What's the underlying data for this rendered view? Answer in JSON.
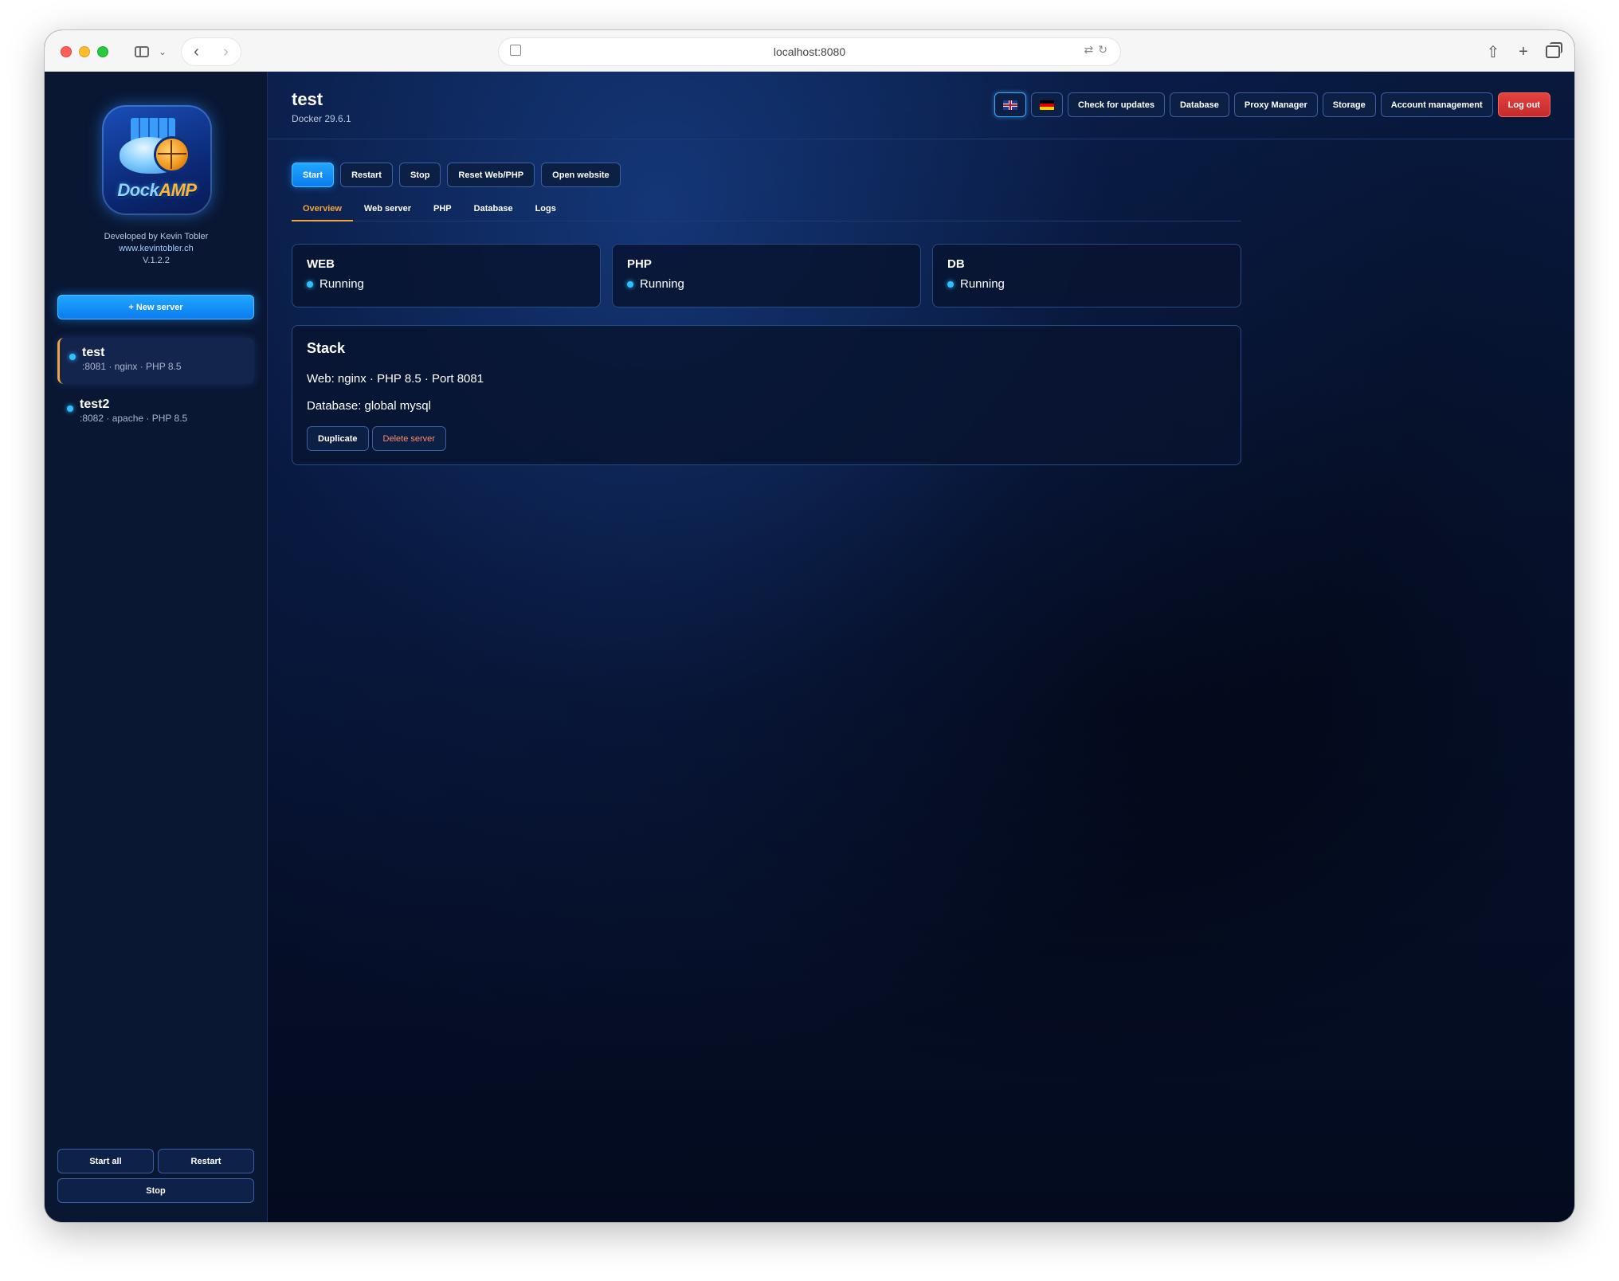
{
  "browser": {
    "url": "localhost:8080"
  },
  "sidebar": {
    "logo": {
      "text_part1": "Dock",
      "text_part2": "AMP"
    },
    "credits": {
      "developer": "Developed by Kevin Tobler",
      "website": "www.kevintobler.ch",
      "version": "V.1.2.2"
    },
    "new_server_label": "+ New server",
    "servers": [
      {
        "name": "test",
        "meta": ":8081 · nginx · PHP 8.5",
        "active": true
      },
      {
        "name": "test2",
        "meta": ":8082 · apache · PHP 8.5",
        "active": false
      }
    ],
    "start_all_label": "Start all",
    "restart_label": "Restart",
    "stop_label": "Stop"
  },
  "header": {
    "title": "test",
    "subtitle": "Docker 29.6.1",
    "buttons": {
      "check_updates": "Check for updates",
      "database": "Database",
      "proxy_manager": "Proxy Manager",
      "storage": "Storage",
      "account_management": "Account management",
      "logout": "Log out"
    }
  },
  "actions": {
    "start": "Start",
    "restart": "Restart",
    "stop": "Stop",
    "reset": "Reset Web/PHP",
    "open_website": "Open website"
  },
  "tabs": [
    "Overview",
    "Web server",
    "PHP",
    "Database",
    "Logs"
  ],
  "status_cards": [
    {
      "title": "WEB",
      "status": "Running"
    },
    {
      "title": "PHP",
      "status": "Running"
    },
    {
      "title": "DB",
      "status": "Running"
    }
  ],
  "stack": {
    "title": "Stack",
    "web_line": "Web: nginx · PHP 8.5 · Port 8081",
    "db_line": "Database: global mysql",
    "duplicate_label": "Duplicate",
    "delete_label": "Delete server"
  },
  "colors": {
    "accent_blue": "#0a7cf0",
    "accent_orange": "#f2a53a",
    "running_dot": "#2fc0ff",
    "danger": "#c62a2a"
  }
}
